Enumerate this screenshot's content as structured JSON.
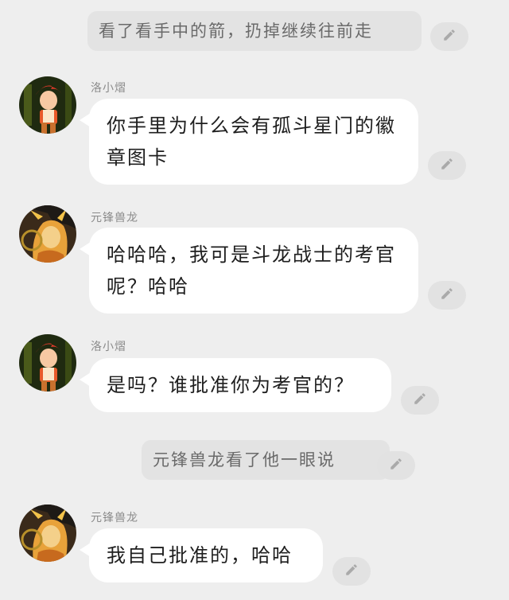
{
  "narrations": [
    {
      "text": "看了看手中的箭，扔掉继续往前走"
    },
    {
      "text": "元锋兽龙看了他一眼说"
    }
  ],
  "messages": [
    {
      "speaker": "洛小熠",
      "text": "你手里为什么会有孤斗星门的徽章图卡",
      "avatar": "red-haired-boy"
    },
    {
      "speaker": "元锋兽龙",
      "text": "哈哈哈，我可是斗龙战士的考官呢？哈哈",
      "avatar": "golden-dragon"
    },
    {
      "speaker": "洛小熠",
      "text": "是吗？谁批准你为考官的？",
      "avatar": "red-haired-boy"
    },
    {
      "speaker": "元锋兽龙",
      "text": "我自己批准的，哈哈",
      "avatar": "golden-dragon"
    }
  ],
  "icons": {
    "edit": "pencil-icon"
  },
  "colors": {
    "background": "#eeeeee",
    "bubble": "#ffffff",
    "narration": "#e3e3e3",
    "edit_button": "#e2e2e2"
  }
}
